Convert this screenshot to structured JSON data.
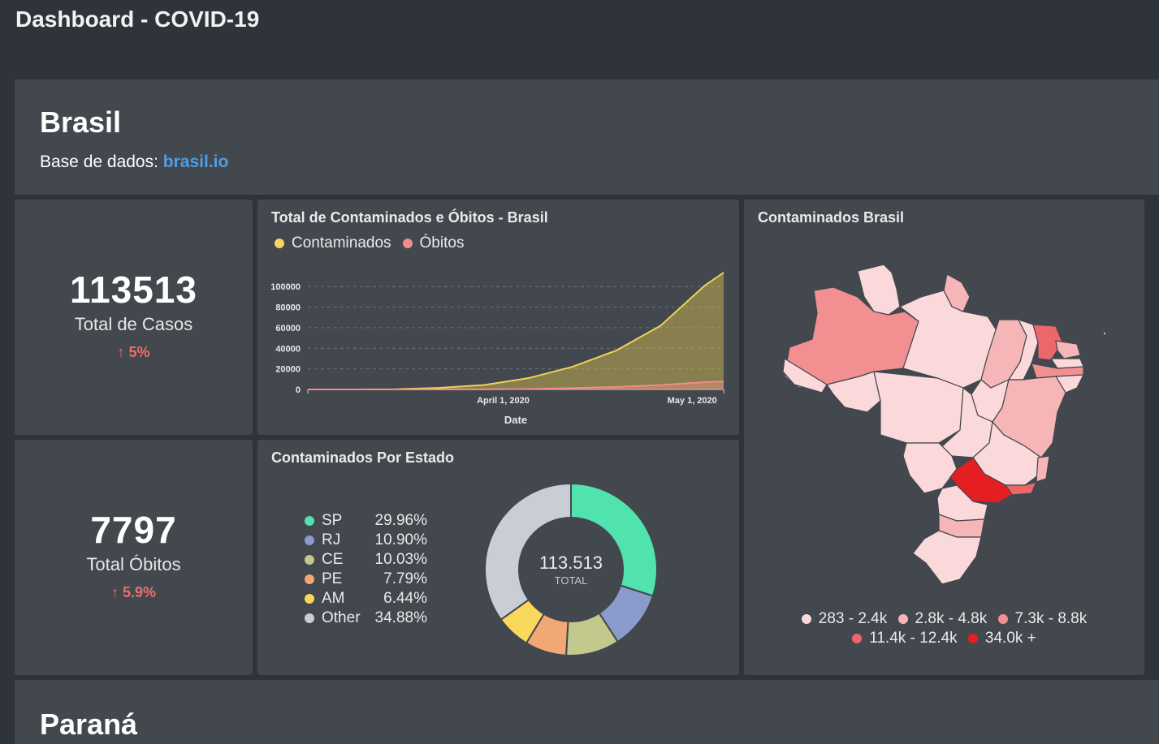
{
  "app": {
    "title": "Dashboard - COVID-19"
  },
  "brasil": {
    "title": "Brasil",
    "source_label": "Base de dados:",
    "source_link": "brasil.io"
  },
  "kpis": {
    "cases": {
      "value": "113513",
      "label": "Total de Casos",
      "change": "5%",
      "arrow": "↑"
    },
    "deaths": {
      "value": "7797",
      "label": "Total Óbitos",
      "change": "5.9%",
      "arrow": "↑"
    }
  },
  "timeline": {
    "title": "Total de Contaminados e Óbitos - Brasil",
    "legend": [
      {
        "label": "Contaminados",
        "color": "#f9d45c"
      },
      {
        "label": "Óbitos",
        "color": "#ef8c8c"
      }
    ],
    "xlabel": "Date",
    "x_ticks": [
      "April 1, 2020",
      "May 1, 2020"
    ],
    "y_ticks": [
      "0",
      "20000",
      "40000",
      "60000",
      "80000",
      "100000"
    ]
  },
  "states": {
    "title": "Contaminados Por Estado",
    "center_value": "113.513",
    "center_label": "TOTAL",
    "items": [
      {
        "name": "SP",
        "pct": "29.96%",
        "color": "#51e3ae"
      },
      {
        "name": "RJ",
        "pct": "10.90%",
        "color": "#8b9bcb"
      },
      {
        "name": "CE",
        "pct": "10.03%",
        "color": "#c3c98c"
      },
      {
        "name": "PE",
        "pct": "7.79%",
        "color": "#f2a874"
      },
      {
        "name": "AM",
        "pct": "6.44%",
        "color": "#f9d85c"
      },
      {
        "name": "Other",
        "pct": "34.88%",
        "color": "#c9ced6"
      }
    ]
  },
  "map": {
    "title": "Contaminados Brasil",
    "legend": [
      {
        "label": "283 - 2.4k",
        "color": "#fbd9da"
      },
      {
        "label": "2.8k - 4.8k",
        "color": "#f6b5b6"
      },
      {
        "label": "7.3k - 8.8k",
        "color": "#f18f91"
      },
      {
        "label": "11.4k - 12.4k",
        "color": "#ec6769"
      },
      {
        "label": "34.0k +",
        "color": "#e41e23"
      }
    ]
  },
  "parana": {
    "title": "Paraná"
  },
  "chart_data": [
    {
      "type": "area",
      "title": "Total de Contaminados e Óbitos - Brasil",
      "xlabel": "Date",
      "ylabel": "",
      "x": [
        "2020-03-01",
        "2020-03-08",
        "2020-03-15",
        "2020-03-22",
        "2020-03-29",
        "2020-04-05",
        "2020-04-12",
        "2020-04-19",
        "2020-04-26",
        "2020-05-03",
        "2020-05-06"
      ],
      "ylim": [
        0,
        113513
      ],
      "series": [
        {
          "name": "Contaminados",
          "values": [
            2,
            25,
            200,
            1600,
            4300,
            11000,
            22000,
            38000,
            62000,
            101000,
            113513
          ]
        },
        {
          "name": "Óbitos",
          "values": [
            0,
            0,
            0,
            25,
            140,
            480,
            1250,
            2460,
            4270,
            7050,
            7797
          ]
        }
      ]
    },
    {
      "type": "pie",
      "title": "Contaminados Por Estado",
      "categories": [
        "SP",
        "RJ",
        "CE",
        "PE",
        "AM",
        "Other"
      ],
      "values": [
        29.96,
        10.9,
        10.03,
        7.79,
        6.44,
        34.88
      ]
    }
  ]
}
